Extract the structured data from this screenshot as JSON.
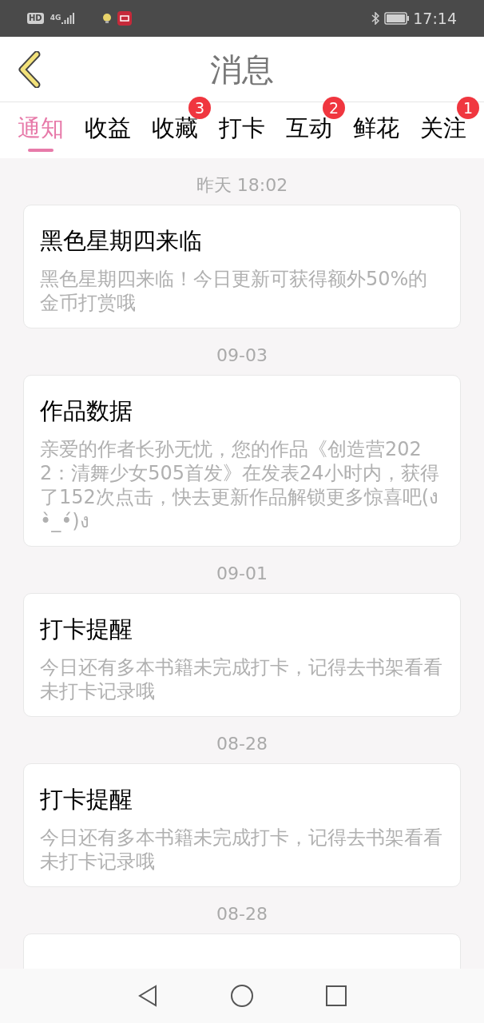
{
  "status_bar": {
    "hd": "HD",
    "network": "4G",
    "time": "17:14"
  },
  "header": {
    "title": "消息"
  },
  "tabs": [
    {
      "label": "通知",
      "selected": true
    },
    {
      "label": "收益",
      "selected": false
    },
    {
      "label": "收藏",
      "selected": false,
      "badge": "3"
    },
    {
      "label": "打卡",
      "selected": false
    },
    {
      "label": "互动",
      "selected": false,
      "badge": "2"
    },
    {
      "label": "鲜花",
      "selected": false
    },
    {
      "label": "关注",
      "selected": false,
      "badge": "1"
    }
  ],
  "messages": [
    {
      "date": "昨天 18:02",
      "title": "黑色星期四来临",
      "body": "黑色星期四来临！今日更新可获得额外50%的金币打赏哦"
    },
    {
      "date": "09-03",
      "title": "作品数据",
      "body": "亲爱的作者长孙无忧，您的作品《创造营2022：清舞少女505首发》在发表24小时内，获得了152次点击，快去更新作品解锁更多惊喜吧(ง •̀_•́)ง"
    },
    {
      "date": "09-01",
      "title": "打卡提醒",
      "body": "今日还有多本书籍未完成打卡，记得去书架看看未打卡记录哦"
    },
    {
      "date": "08-28",
      "title": "打卡提醒",
      "body": "今日还有多本书籍未完成打卡，记得去书架看看未打卡记录哦"
    },
    {
      "date": "08-28"
    }
  ]
}
